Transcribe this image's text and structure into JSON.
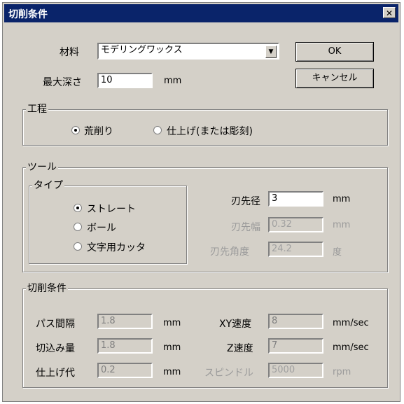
{
  "window": {
    "title": "切削条件",
    "close_glyph": "✕"
  },
  "material": {
    "label": "材料",
    "value": "モデリングワックス"
  },
  "max_depth": {
    "label": "最大深さ",
    "value": "10",
    "unit": "mm"
  },
  "buttons": {
    "ok": "OK",
    "cancel": "キャンセル"
  },
  "process": {
    "title": "工程",
    "options": [
      {
        "label": "荒削り",
        "selected": true
      },
      {
        "label": "仕上げ(または彫刻)",
        "selected": false
      }
    ]
  },
  "tool": {
    "title": "ツール",
    "type_group": {
      "title": "タイプ",
      "options": [
        {
          "label": "ストレート",
          "selected": true
        },
        {
          "label": "ボール",
          "selected": false
        },
        {
          "label": "文字用カッタ",
          "selected": false
        }
      ]
    },
    "diameter": {
      "label": "刃先径",
      "value": "3",
      "unit": "mm"
    },
    "width": {
      "label": "刃先幅",
      "value": "0.32",
      "unit": "mm"
    },
    "angle": {
      "label": "刃先角度",
      "value": "24.2",
      "unit": "度"
    }
  },
  "cutting": {
    "title": "切削条件",
    "pass_interval": {
      "label": "パス間隔",
      "value": "1.8",
      "unit": "mm"
    },
    "cut_amount": {
      "label": "切込み量",
      "value": "1.8",
      "unit": "mm"
    },
    "finish_allowance": {
      "label": "仕上げ代",
      "value": "0.2",
      "unit": "mm"
    },
    "xy_speed": {
      "label": "XY速度",
      "value": "8",
      "unit": "mm/sec"
    },
    "z_speed": {
      "label": "Z速度",
      "value": "7",
      "unit": "mm/sec"
    },
    "spindle": {
      "label": "スピンドル",
      "value": "5000",
      "unit": "rpm"
    }
  }
}
